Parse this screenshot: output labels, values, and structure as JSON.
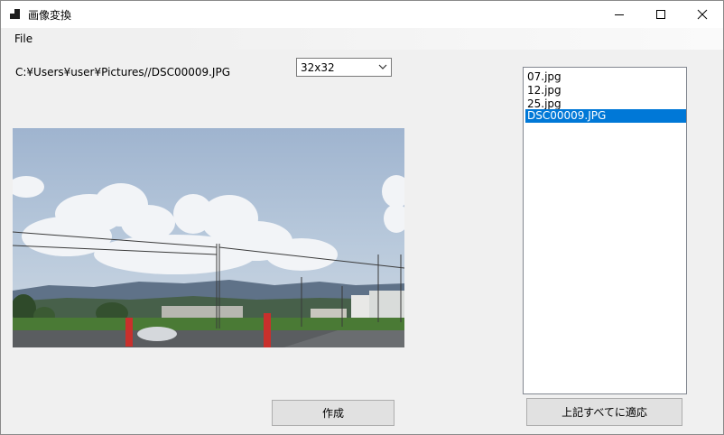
{
  "window": {
    "title": "画像変換"
  },
  "menu": {
    "file": "File"
  },
  "file_path": "C:¥Users¥user¥Pictures//DSC00009.JPG",
  "size_select": {
    "value": "32x32"
  },
  "files": [
    {
      "name": "07.jpg",
      "selected": false
    },
    {
      "name": "12.jpg",
      "selected": false
    },
    {
      "name": "25.jpg",
      "selected": false
    },
    {
      "name": "DSC00009.JPG",
      "selected": true
    }
  ],
  "buttons": {
    "create": "作成",
    "apply_all": "上記すべてに適応"
  },
  "colors": {
    "selection": "#0078d7"
  }
}
